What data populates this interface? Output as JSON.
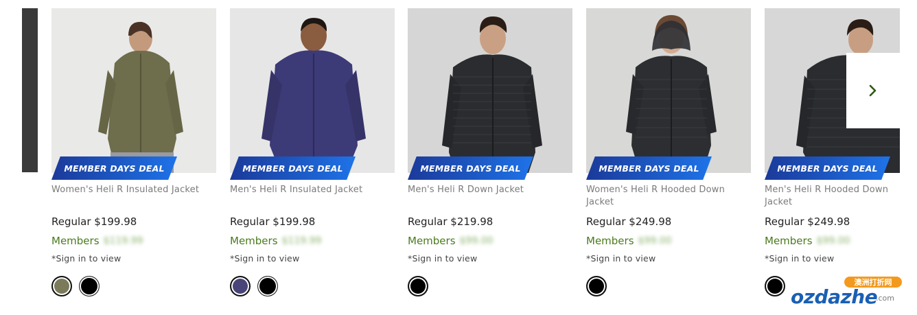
{
  "products": [
    {
      "name": "Women's Heli R Insulated Jacket",
      "badge": "MEMBER DAYS DEAL",
      "regular_label": "Regular $199.98",
      "members_label": "Members",
      "members_price": "$119.99",
      "signin": "*Sign in to view",
      "swatches": [
        "#7b7a5a",
        "#000000"
      ]
    },
    {
      "name": "Men's Heli R Insulated Jacket",
      "badge": "MEMBER DAYS DEAL",
      "regular_label": "Regular $199.98",
      "members_label": "Members",
      "members_price": "$119.99",
      "signin": "*Sign in to view",
      "swatches": [
        "#4a4578",
        "#000000"
      ]
    },
    {
      "name": "Men's Heli R Down Jacket",
      "badge": "MEMBER DAYS DEAL",
      "regular_label": "Regular $219.98",
      "members_label": "Members",
      "members_price": "$99.00",
      "signin": "*Sign in to view",
      "swatches": [
        "#000000"
      ]
    },
    {
      "name": "Women's Heli R Hooded Down Jacket",
      "badge": "MEMBER DAYS DEAL",
      "regular_label": "Regular $249.98",
      "members_label": "Members",
      "members_price": "$99.00",
      "signin": "*Sign in to view",
      "swatches": [
        "#000000"
      ]
    },
    {
      "name": "Men's Heli R Hooded Down Jacket",
      "badge": "MEMBER DAYS DEAL",
      "regular_label": "Regular $249.98",
      "members_label": "Members",
      "members_price": "$99.00",
      "signin": "*Sign in to view",
      "swatches": [
        "#000000"
      ]
    }
  ],
  "carousel": {
    "next_icon": "chevron-right-icon"
  },
  "watermark": {
    "top": "澳洲打折网",
    "main": "ozdazhe",
    "suffix": ".com"
  },
  "colors": {
    "badge_start": "#1b3a9a",
    "badge_end": "#1e73e8",
    "members_green": "#4a7a1c",
    "chevron": "#2f5a14"
  }
}
